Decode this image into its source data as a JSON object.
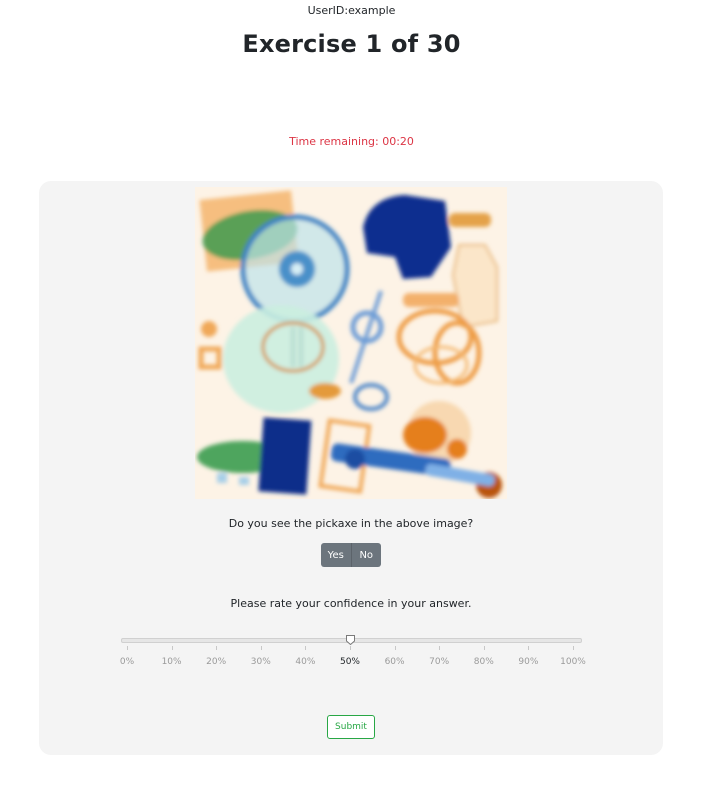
{
  "header": {
    "user_id": "UserID:example",
    "title": "Exercise 1 of 30",
    "timer": "Time remaining: 00:20"
  },
  "exercise": {
    "question": "Do you see the pickaxe in the above image?",
    "yes_label": "Yes",
    "no_label": "No",
    "confidence_prompt": "Please rate your confidence in your answer.",
    "confidence_ticks": [
      "0%",
      "10%",
      "20%",
      "30%",
      "40%",
      "50%",
      "60%",
      "70%",
      "80%",
      "90%",
      "100%"
    ],
    "confidence_value": 50,
    "submit_label": "Submit"
  },
  "colors": {
    "timer": "#dc3545",
    "buttons": "#6c757d",
    "submit": "#28a745",
    "card": "#f4f4f4"
  }
}
